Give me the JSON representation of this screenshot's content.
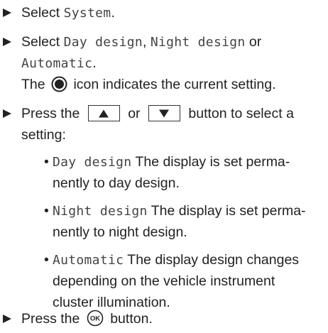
{
  "instructions": {
    "step1": {
      "prefix": "Select ",
      "option": "System",
      "suffix": "."
    },
    "step2": {
      "prefix": "Select ",
      "option_day": "Day design",
      "sep": ", ",
      "option_night": "Night design",
      "or_word": " or",
      "option_auto": "Automatic",
      "suffix": ".",
      "note_prefix": "The ",
      "note_suffix": " icon indicates the current setting.",
      "note_icon": "radio-selected-icon"
    },
    "step3": {
      "prefix": "Press the ",
      "or_word": " or ",
      "suffix_line1": " button to select a",
      "line2": "setting:",
      "up_icon": "up-triangle-icon",
      "down_icon": "down-triangle-icon"
    },
    "bullets": [
      {
        "term": "Day design",
        "line1": " The display is set perma-",
        "line2": "nently to day design."
      },
      {
        "term": "Night design",
        "line1": " The display is set perma-",
        "line2": "nently to night design."
      },
      {
        "term": "Automatic",
        "line1": " The display design changes",
        "line2": "depending on the vehicle instrument",
        "line3": "cluster illumination."
      }
    ],
    "step4": {
      "prefix": "Press the ",
      "suffix": " button.",
      "ok_label": "OK",
      "ok_icon": "ok-button-icon"
    },
    "bullet_char": "•",
    "colors": {
      "text": "#222222",
      "mono_text": "#444444"
    }
  }
}
